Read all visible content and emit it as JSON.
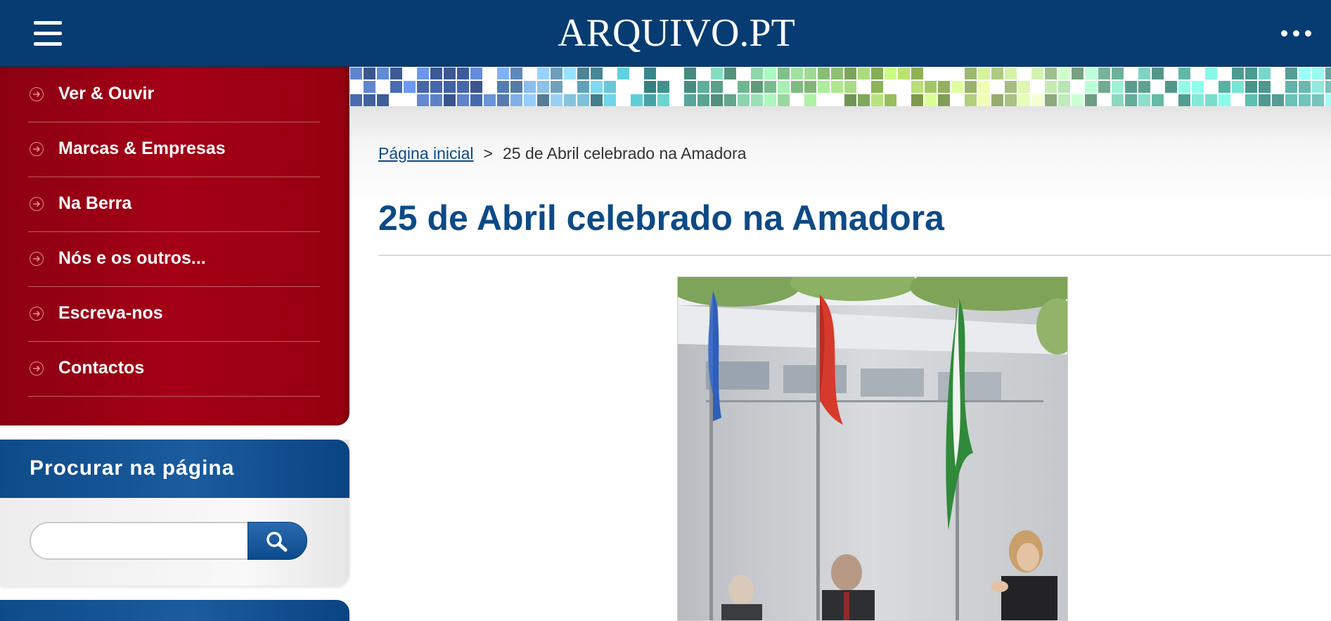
{
  "header": {
    "logo_text": "ARQUIVO.PT",
    "menu_icon": "hamburger-icon",
    "more_icon": "more-dots-icon",
    "background": "#063c72"
  },
  "sidebar": {
    "menu_color": "#a40016",
    "items": [
      {
        "label": "Ver & Ouvir",
        "icon": "arrow-circle-icon"
      },
      {
        "label": "Marcas & Empresas",
        "icon": "arrow-circle-icon"
      },
      {
        "label": "Na Berra",
        "icon": "arrow-circle-icon"
      },
      {
        "label": "Nós e os outros...",
        "icon": "arrow-circle-icon"
      },
      {
        "label": "Escreva-nos",
        "icon": "arrow-circle-icon"
      },
      {
        "label": "Contactos",
        "icon": "arrow-circle-icon"
      }
    ]
  },
  "search": {
    "title": "Procurar na página",
    "value": "",
    "placeholder": "",
    "button_icon": "search-icon"
  },
  "breadcrumb": {
    "home": "Página inicial",
    "separator": ">",
    "current": "25 de Abril celebrado na Amadora"
  },
  "article": {
    "title": "25 de Abril celebrado na Amadora",
    "title_color": "#0d4a86"
  }
}
